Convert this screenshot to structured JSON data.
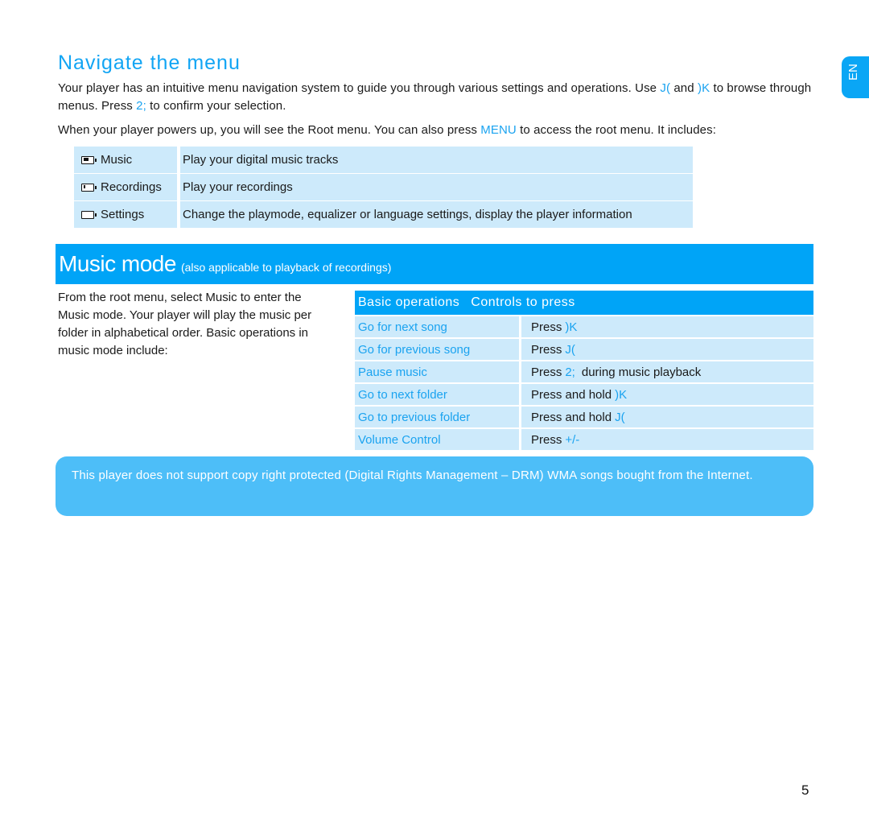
{
  "navigate": {
    "title": "Navigate the menu",
    "p1": {
      "a": "Your player has an intuitive menu navigation system to guide you through various settings and operations. Use ",
      "k1": "J(",
      "b": " and ",
      "k2": ")K",
      "c": " to browse through menus. Press ",
      "k3": "2;",
      "d": " to confirm your selection."
    },
    "p2": {
      "a": "When your player powers up, you will see the Root menu. You can also press ",
      "k1": "MENU",
      "b": " to access the root menu. It includes:"
    }
  },
  "language_tab": "EN",
  "root_menu": [
    {
      "icon": "battery-full-icon",
      "name": "Music",
      "desc": "Play your digital music tracks",
      "fill": 0.5
    },
    {
      "icon": "battery-low-icon",
      "name": "Recordings",
      "desc": "Play your recordings",
      "fill": 0.2
    },
    {
      "icon": "battery-empty-icon",
      "name": "Settings",
      "desc": "Change the playmode, equalizer or language settings, display the player information",
      "fill": 0
    }
  ],
  "music_mode": {
    "title": "Music mode",
    "subtitle": "(also applicable to playback of recordings)",
    "intro": "From the root menu, select Music to enter the Music mode. Your player will play the music per folder in alphabetical order. Basic operations in music mode include:"
  },
  "operations": {
    "header_op": "Basic operations",
    "header_ctl": "Controls to press",
    "rows": [
      {
        "op": "Go for next song",
        "ctl": "Press",
        "key": ")K",
        "suffix": ""
      },
      {
        "op": "Go for previous song",
        "ctl": "Press",
        "key": "J(",
        "suffix": ""
      },
      {
        "op": "Pause music",
        "ctl": "Press",
        "key": "2;",
        "suffix": "during music playback"
      },
      {
        "op": "Go to next folder",
        "ctl": "Press and hold",
        "key": ")K",
        "suffix": ""
      },
      {
        "op": "Go to previous folder",
        "ctl": "Press and hold",
        "key": "J(",
        "suffix": ""
      },
      {
        "op": "Volume Control",
        "ctl": "Press",
        "key": "+/-",
        "suffix": ""
      }
    ]
  },
  "notice": "This player does not support copy right protected (Digital Rights Management – DRM) WMA songs bought from the Internet.",
  "page_number": "5"
}
